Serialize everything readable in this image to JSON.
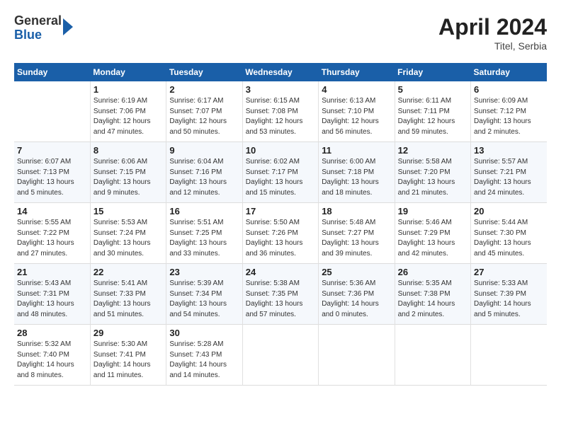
{
  "header": {
    "logo_line1": "General",
    "logo_line2": "Blue",
    "title": "April 2024",
    "subtitle": "Titel, Serbia"
  },
  "days_of_week": [
    "Sunday",
    "Monday",
    "Tuesday",
    "Wednesday",
    "Thursday",
    "Friday",
    "Saturday"
  ],
  "weeks": [
    [
      {
        "num": "",
        "info": ""
      },
      {
        "num": "1",
        "info": "Sunrise: 6:19 AM\nSunset: 7:06 PM\nDaylight: 12 hours\nand 47 minutes."
      },
      {
        "num": "2",
        "info": "Sunrise: 6:17 AM\nSunset: 7:07 PM\nDaylight: 12 hours\nand 50 minutes."
      },
      {
        "num": "3",
        "info": "Sunrise: 6:15 AM\nSunset: 7:08 PM\nDaylight: 12 hours\nand 53 minutes."
      },
      {
        "num": "4",
        "info": "Sunrise: 6:13 AM\nSunset: 7:10 PM\nDaylight: 12 hours\nand 56 minutes."
      },
      {
        "num": "5",
        "info": "Sunrise: 6:11 AM\nSunset: 7:11 PM\nDaylight: 12 hours\nand 59 minutes."
      },
      {
        "num": "6",
        "info": "Sunrise: 6:09 AM\nSunset: 7:12 PM\nDaylight: 13 hours\nand 2 minutes."
      }
    ],
    [
      {
        "num": "7",
        "info": "Sunrise: 6:07 AM\nSunset: 7:13 PM\nDaylight: 13 hours\nand 5 minutes."
      },
      {
        "num": "8",
        "info": "Sunrise: 6:06 AM\nSunset: 7:15 PM\nDaylight: 13 hours\nand 9 minutes."
      },
      {
        "num": "9",
        "info": "Sunrise: 6:04 AM\nSunset: 7:16 PM\nDaylight: 13 hours\nand 12 minutes."
      },
      {
        "num": "10",
        "info": "Sunrise: 6:02 AM\nSunset: 7:17 PM\nDaylight: 13 hours\nand 15 minutes."
      },
      {
        "num": "11",
        "info": "Sunrise: 6:00 AM\nSunset: 7:18 PM\nDaylight: 13 hours\nand 18 minutes."
      },
      {
        "num": "12",
        "info": "Sunrise: 5:58 AM\nSunset: 7:20 PM\nDaylight: 13 hours\nand 21 minutes."
      },
      {
        "num": "13",
        "info": "Sunrise: 5:57 AM\nSunset: 7:21 PM\nDaylight: 13 hours\nand 24 minutes."
      }
    ],
    [
      {
        "num": "14",
        "info": "Sunrise: 5:55 AM\nSunset: 7:22 PM\nDaylight: 13 hours\nand 27 minutes."
      },
      {
        "num": "15",
        "info": "Sunrise: 5:53 AM\nSunset: 7:24 PM\nDaylight: 13 hours\nand 30 minutes."
      },
      {
        "num": "16",
        "info": "Sunrise: 5:51 AM\nSunset: 7:25 PM\nDaylight: 13 hours\nand 33 minutes."
      },
      {
        "num": "17",
        "info": "Sunrise: 5:50 AM\nSunset: 7:26 PM\nDaylight: 13 hours\nand 36 minutes."
      },
      {
        "num": "18",
        "info": "Sunrise: 5:48 AM\nSunset: 7:27 PM\nDaylight: 13 hours\nand 39 minutes."
      },
      {
        "num": "19",
        "info": "Sunrise: 5:46 AM\nSunset: 7:29 PM\nDaylight: 13 hours\nand 42 minutes."
      },
      {
        "num": "20",
        "info": "Sunrise: 5:44 AM\nSunset: 7:30 PM\nDaylight: 13 hours\nand 45 minutes."
      }
    ],
    [
      {
        "num": "21",
        "info": "Sunrise: 5:43 AM\nSunset: 7:31 PM\nDaylight: 13 hours\nand 48 minutes."
      },
      {
        "num": "22",
        "info": "Sunrise: 5:41 AM\nSunset: 7:33 PM\nDaylight: 13 hours\nand 51 minutes."
      },
      {
        "num": "23",
        "info": "Sunrise: 5:39 AM\nSunset: 7:34 PM\nDaylight: 13 hours\nand 54 minutes."
      },
      {
        "num": "24",
        "info": "Sunrise: 5:38 AM\nSunset: 7:35 PM\nDaylight: 13 hours\nand 57 minutes."
      },
      {
        "num": "25",
        "info": "Sunrise: 5:36 AM\nSunset: 7:36 PM\nDaylight: 14 hours\nand 0 minutes."
      },
      {
        "num": "26",
        "info": "Sunrise: 5:35 AM\nSunset: 7:38 PM\nDaylight: 14 hours\nand 2 minutes."
      },
      {
        "num": "27",
        "info": "Sunrise: 5:33 AM\nSunset: 7:39 PM\nDaylight: 14 hours\nand 5 minutes."
      }
    ],
    [
      {
        "num": "28",
        "info": "Sunrise: 5:32 AM\nSunset: 7:40 PM\nDaylight: 14 hours\nand 8 minutes."
      },
      {
        "num": "29",
        "info": "Sunrise: 5:30 AM\nSunset: 7:41 PM\nDaylight: 14 hours\nand 11 minutes."
      },
      {
        "num": "30",
        "info": "Sunrise: 5:28 AM\nSunset: 7:43 PM\nDaylight: 14 hours\nand 14 minutes."
      },
      {
        "num": "",
        "info": ""
      },
      {
        "num": "",
        "info": ""
      },
      {
        "num": "",
        "info": ""
      },
      {
        "num": "",
        "info": ""
      }
    ]
  ]
}
